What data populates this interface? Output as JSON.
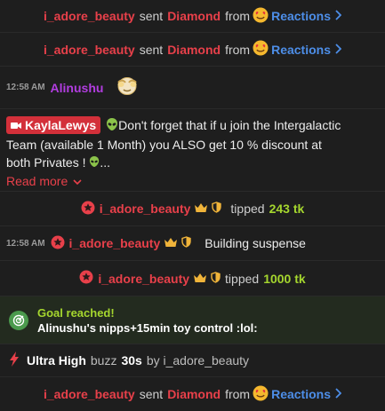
{
  "rows": [
    {
      "user": "i_adore_beauty",
      "sent": "sent",
      "item": "Diamond",
      "from": "from",
      "link": "Reactions"
    },
    {
      "user": "i_adore_beauty",
      "sent": "sent",
      "item": "Diamond",
      "from": "from",
      "link": "Reactions"
    }
  ],
  "mini_message": {
    "time": "12:58 AM",
    "user": "Alinushu"
  },
  "announcement": {
    "badge": "KaylaLewys",
    "text_line1": "Don't forget that if u join the Intergalactic",
    "text_line2": "Team (available 1 Month) you ALSO get 10 % discount at",
    "text_line3": "both Privates !",
    "ellipsis": "...",
    "read_more": "Read more"
  },
  "tip1": {
    "user": "i_adore_beauty",
    "verb": "tipped",
    "amount": "243 tk"
  },
  "chat2": {
    "time": "12:58 AM",
    "user": "i_adore_beauty",
    "message": "Building suspense"
  },
  "tip2": {
    "user": "i_adore_beauty",
    "verb": "tipped",
    "amount": "1000 tk"
  },
  "goal": {
    "title": "Goal reached!",
    "description": "Alinushu's nipps+15min toy control :lol:"
  },
  "buzz": {
    "level": "Ultra High",
    "word": "buzz",
    "duration": "30s",
    "by": "by i_adore_beauty"
  },
  "last_row": {
    "user": "i_adore_beauty",
    "sent": "sent",
    "item": "Diamond",
    "from": "from",
    "link": "Reactions"
  },
  "colors": {
    "accent_red": "#e8404a",
    "link_blue": "#4d8ee8",
    "tip_green": "#a5d62e",
    "username_purple": "#b23de0"
  }
}
